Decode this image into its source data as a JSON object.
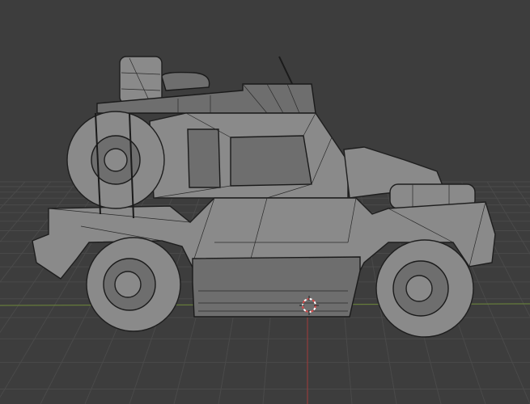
{
  "viewport": {
    "shading": "wireframe",
    "colors": {
      "background": "#3d3d3d",
      "grid": "#4a4a4a",
      "x_axis": "#6f8a3a",
      "y_axis": "#a33a3a",
      "mesh": "#8a8a8a",
      "wire": "#1e1e1e",
      "cursor": "#d84a4a"
    }
  }
}
